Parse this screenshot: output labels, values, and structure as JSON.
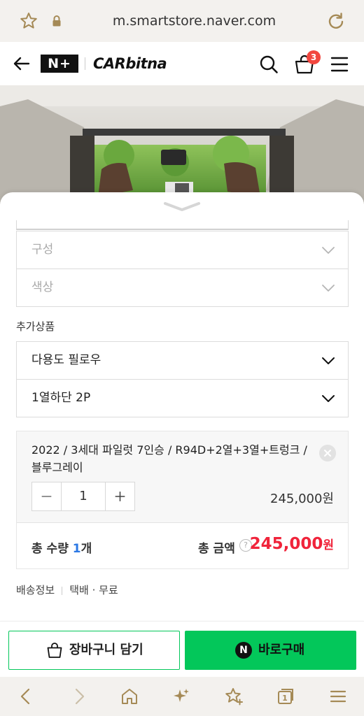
{
  "browser": {
    "url": "m.smartstore.naver.com"
  },
  "header": {
    "brand_nplus": "N+",
    "brand_store": "CARbitna",
    "cart_count": "3"
  },
  "options": {
    "rows": [
      {
        "label": "구성",
        "state": "disabled"
      },
      {
        "label": "색상",
        "state": "disabled"
      }
    ]
  },
  "addons": {
    "section_label": "추가상품",
    "rows": [
      {
        "label": "다용도 필로우"
      },
      {
        "label": "1열하단 2P"
      }
    ]
  },
  "selected_item": {
    "name": "2022 / 3세대 파일럿 7인승 / R94D+2열+3열+트렁크 / 블루그레이",
    "quantity": "1",
    "price": "245,000원"
  },
  "totals": {
    "qty_label": "총 수량",
    "qty_value": "1",
    "qty_unit": "개",
    "amount_label": "총 금액",
    "help": "?",
    "amount_value": "245,000",
    "amount_unit": "원"
  },
  "shipping": {
    "label": "배송정보",
    "value": "택배 · 무료"
  },
  "actions": {
    "cart_label": "장바구니 담기",
    "buy_label": "바로구매",
    "buy_logo": "N"
  },
  "colors": {
    "naver_green": "#03c75a",
    "price_red": "#f0243b",
    "badge_red": "#f2473f",
    "qty_blue": "#2b78e4"
  },
  "icons": [
    "star-icon",
    "lock-icon",
    "reload-icon",
    "back-arrow-icon",
    "search-icon",
    "shopping-bag-icon",
    "hamburger-menu-icon",
    "chevron-down-icon",
    "close-icon",
    "minus-icon",
    "plus-icon",
    "help-icon",
    "bag-icon",
    "browser-back-icon",
    "browser-forward-icon",
    "home-icon",
    "sparkle-icon",
    "bookmark-star-icon",
    "tabs-icon",
    "browser-menu-icon"
  ]
}
